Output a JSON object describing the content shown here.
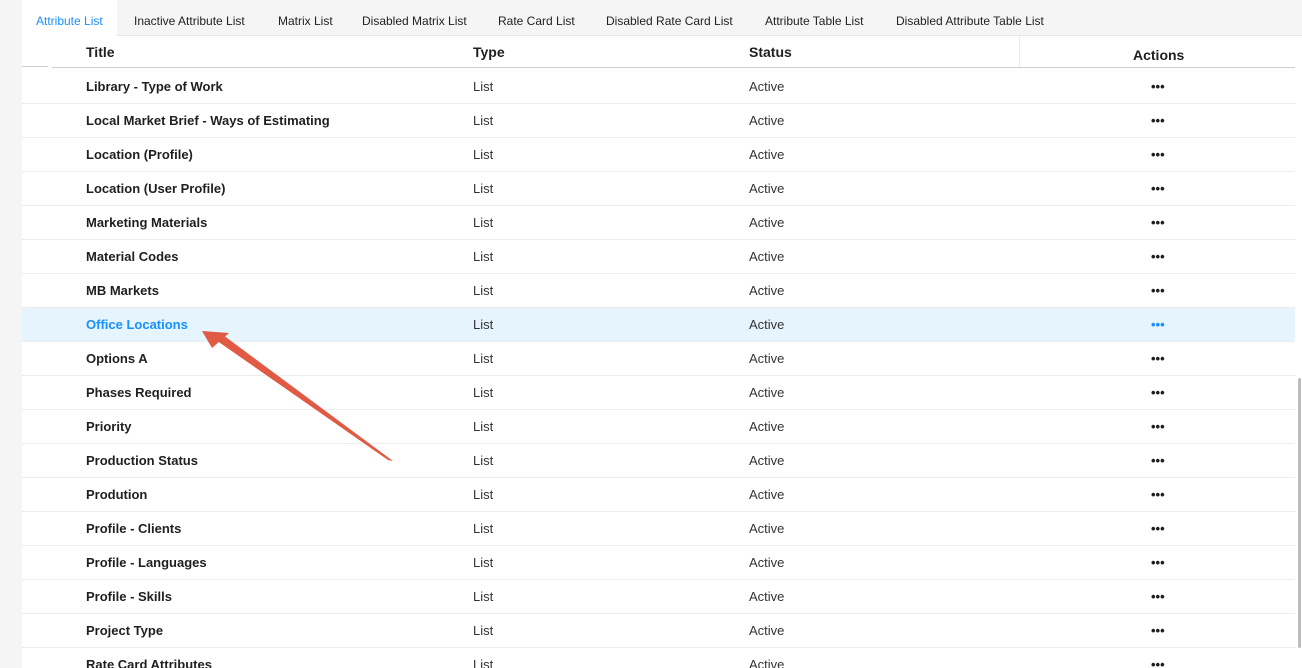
{
  "tabs": [
    {
      "label": "Attribute List",
      "active": true
    },
    {
      "label": "Inactive Attribute List",
      "active": false
    },
    {
      "label": "Matrix List",
      "active": false
    },
    {
      "label": "Disabled Matrix List",
      "active": false
    },
    {
      "label": "Rate Card List",
      "active": false
    },
    {
      "label": "Disabled Rate Card List",
      "active": false
    },
    {
      "label": "Attribute Table List",
      "active": false
    },
    {
      "label": "Disabled Attribute Table List",
      "active": false
    }
  ],
  "table": {
    "headers": {
      "title": "Title",
      "type": "Type",
      "status": "Status",
      "actions": "Actions"
    },
    "rows": [
      {
        "title": "Library - Type of Work",
        "type": "List",
        "status": "Active",
        "actions": "•••"
      },
      {
        "title": "Local Market Brief -  Ways of Estimating",
        "type": "List",
        "status": "Active",
        "actions": "•••"
      },
      {
        "title": "Location (Profile)",
        "type": "List",
        "status": "Active",
        "actions": "•••"
      },
      {
        "title": "Location (User Profile)",
        "type": "List",
        "status": "Active",
        "actions": "•••"
      },
      {
        "title": "Marketing Materials",
        "type": "List",
        "status": "Active",
        "actions": "•••"
      },
      {
        "title": "Material Codes",
        "type": "List",
        "status": "Active",
        "actions": "•••"
      },
      {
        "title": "MB Markets",
        "type": "List",
        "status": "Active",
        "actions": "•••"
      },
      {
        "title": "Office Locations",
        "type": "List",
        "status": "Active",
        "actions": "•••",
        "highlighted": true
      },
      {
        "title": "Options A",
        "type": "List",
        "status": "Active",
        "actions": "•••"
      },
      {
        "title": "Phases Required",
        "type": "List",
        "status": "Active",
        "actions": "•••"
      },
      {
        "title": "Priority",
        "type": "List",
        "status": "Active",
        "actions": "•••"
      },
      {
        "title": "Production Status",
        "type": "List",
        "status": "Active",
        "actions": "•••"
      },
      {
        "title": "Prodution",
        "type": "List",
        "status": "Active",
        "actions": "•••"
      },
      {
        "title": "Profile - Clients",
        "type": "List",
        "status": "Active",
        "actions": "•••"
      },
      {
        "title": "Profile - Languages",
        "type": "List",
        "status": "Active",
        "actions": "•••"
      },
      {
        "title": "Profile - Skills",
        "type": "List",
        "status": "Active",
        "actions": "•••"
      },
      {
        "title": "Project Type",
        "type": "List",
        "status": "Active",
        "actions": "•••"
      },
      {
        "title": "Rate Card Attributes",
        "type": "List",
        "status": "Active",
        "actions": "•••"
      }
    ]
  },
  "annotation": {
    "icon": "arrow-annotation",
    "color": "#e05a44"
  },
  "colors": {
    "accent": "#1890ff",
    "highlight_row": "#e6f4fd",
    "tab_bar": "#f5f5f5"
  }
}
